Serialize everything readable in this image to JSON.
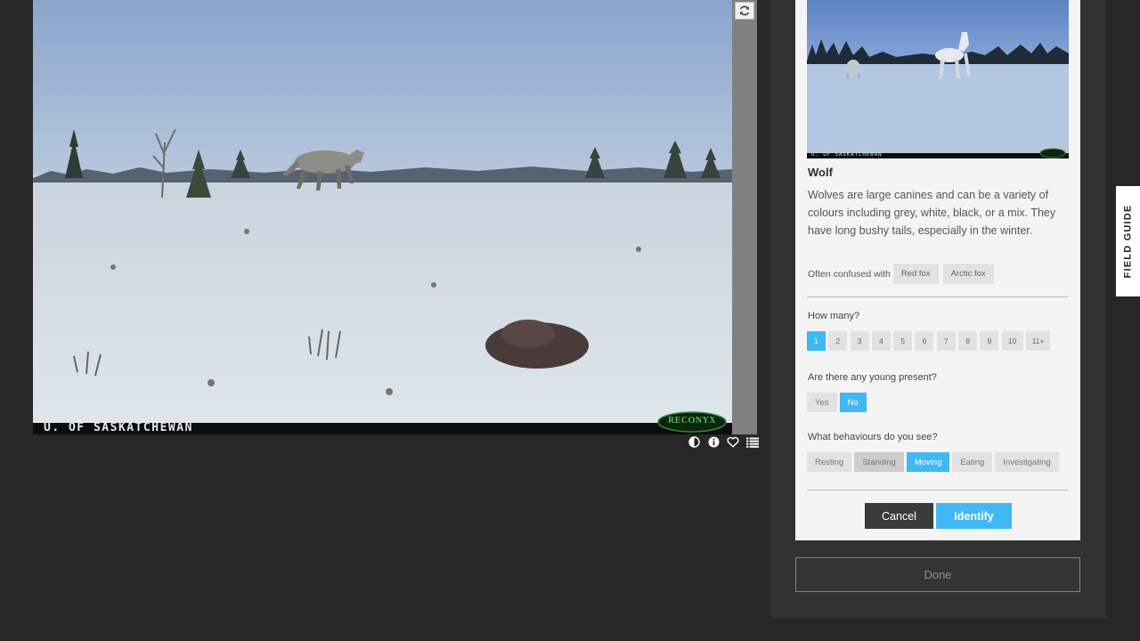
{
  "viewer": {
    "photo_watermark": "U. OF SASKATCHEWAN",
    "camera_brand": "RECONYX",
    "tools": [
      "rotate-icon",
      "contrast-icon",
      "info-icon",
      "heart-icon",
      "collections-icon"
    ]
  },
  "field_guide": {
    "tab_label": "FIELD GUIDE"
  },
  "species": {
    "photo_watermark": "U. OF SASKATCHEWAN",
    "name": "Wolf",
    "description": "Wolves are large canines and can be a variety of colours including grey, white, black, or a mix. They have long bushy tails, especially in the winter.",
    "confused_label": "Often confused with",
    "confused_with": [
      "Red fox",
      "Arctic fox"
    ]
  },
  "questions": {
    "how_many": {
      "label": "How many?",
      "options": [
        "1",
        "2",
        "3",
        "4",
        "5",
        "6",
        "7",
        "8",
        "9",
        "10",
        "11+"
      ],
      "selected": "1"
    },
    "young": {
      "label": "Are there any young present?",
      "options": [
        "Yes",
        "No"
      ],
      "selected": "No"
    },
    "behaviours": {
      "label": "What behaviours do you see?",
      "options": [
        "Resting",
        "Standing",
        "Moving",
        "Eating",
        "Investigating"
      ],
      "selected": "Moving"
    }
  },
  "actions": {
    "cancel": "Cancel",
    "identify": "Identify",
    "done": "Done"
  },
  "colors": {
    "accent": "#3fb9f1",
    "page_bg": "#272727",
    "panel_bg": "#323232"
  }
}
